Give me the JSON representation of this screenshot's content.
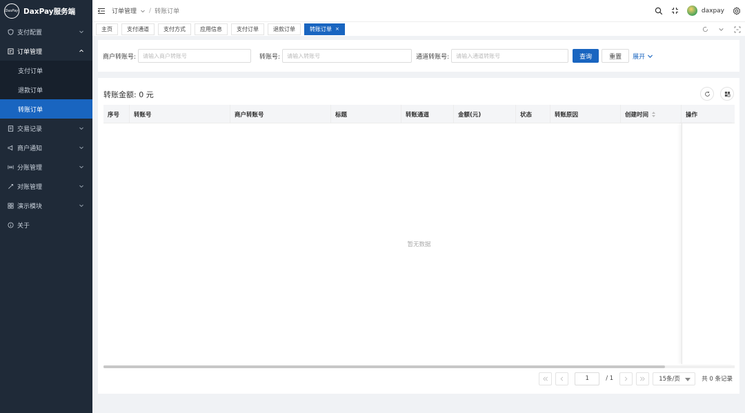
{
  "app": {
    "logo_mark": "DaxPay",
    "title": "DaxPay服务端"
  },
  "sidebar": {
    "items": [
      {
        "label": "支付配置",
        "icon": "shield-icon",
        "expandable": true
      },
      {
        "label": "订单管理",
        "icon": "order-icon",
        "expandable": true,
        "open": true,
        "children": [
          {
            "label": "支付订单"
          },
          {
            "label": "退款订单"
          },
          {
            "label": "转账订单",
            "active": true
          }
        ]
      },
      {
        "label": "交易记录",
        "icon": "record-icon",
        "expandable": true
      },
      {
        "label": "商户通知",
        "icon": "megaphone-icon",
        "expandable": true
      },
      {
        "label": "分账管理",
        "icon": "split-icon",
        "expandable": true
      },
      {
        "label": "对账管理",
        "icon": "reconcile-icon",
        "expandable": true
      },
      {
        "label": "演示模块",
        "icon": "grid-icon",
        "expandable": true
      },
      {
        "label": "关于",
        "icon": "info-icon",
        "expandable": false
      }
    ]
  },
  "header": {
    "breadcrumb": [
      "订单管理",
      "转账订单"
    ],
    "username": "daxpay"
  },
  "tabs": [
    {
      "label": "主页"
    },
    {
      "label": "支付通道"
    },
    {
      "label": "支付方式"
    },
    {
      "label": "应用信息"
    },
    {
      "label": "支付订单"
    },
    {
      "label": "退款订单"
    },
    {
      "label": "转账订单",
      "active": true,
      "close": "×"
    }
  ],
  "search": {
    "merchant_no_label": "商户转账号:",
    "merchant_no_placeholder": "请输入商户转账号",
    "transfer_no_label": "转账号:",
    "transfer_no_placeholder": "请输入转账号",
    "channel_no_label": "通道转账号:",
    "channel_no_placeholder": "请输入通道转账号",
    "query_label": "查询",
    "reset_label": "重置",
    "expand_label": "展开"
  },
  "summary": "转账金额: 0 元",
  "table": {
    "columns": [
      "序号",
      "转账号",
      "商户转账号",
      "标题",
      "转账通道",
      "金额(元)",
      "状态",
      "转账原因",
      "创建时间",
      "操作"
    ],
    "empty_text": "暂无数据"
  },
  "pagination": {
    "current_page": "1",
    "total_pages": "/ 1",
    "page_size": "15条/页",
    "total": "共 0 条记录"
  },
  "colors": {
    "sidebar_bg": "#1f2a38",
    "accent": "#1965c0"
  }
}
